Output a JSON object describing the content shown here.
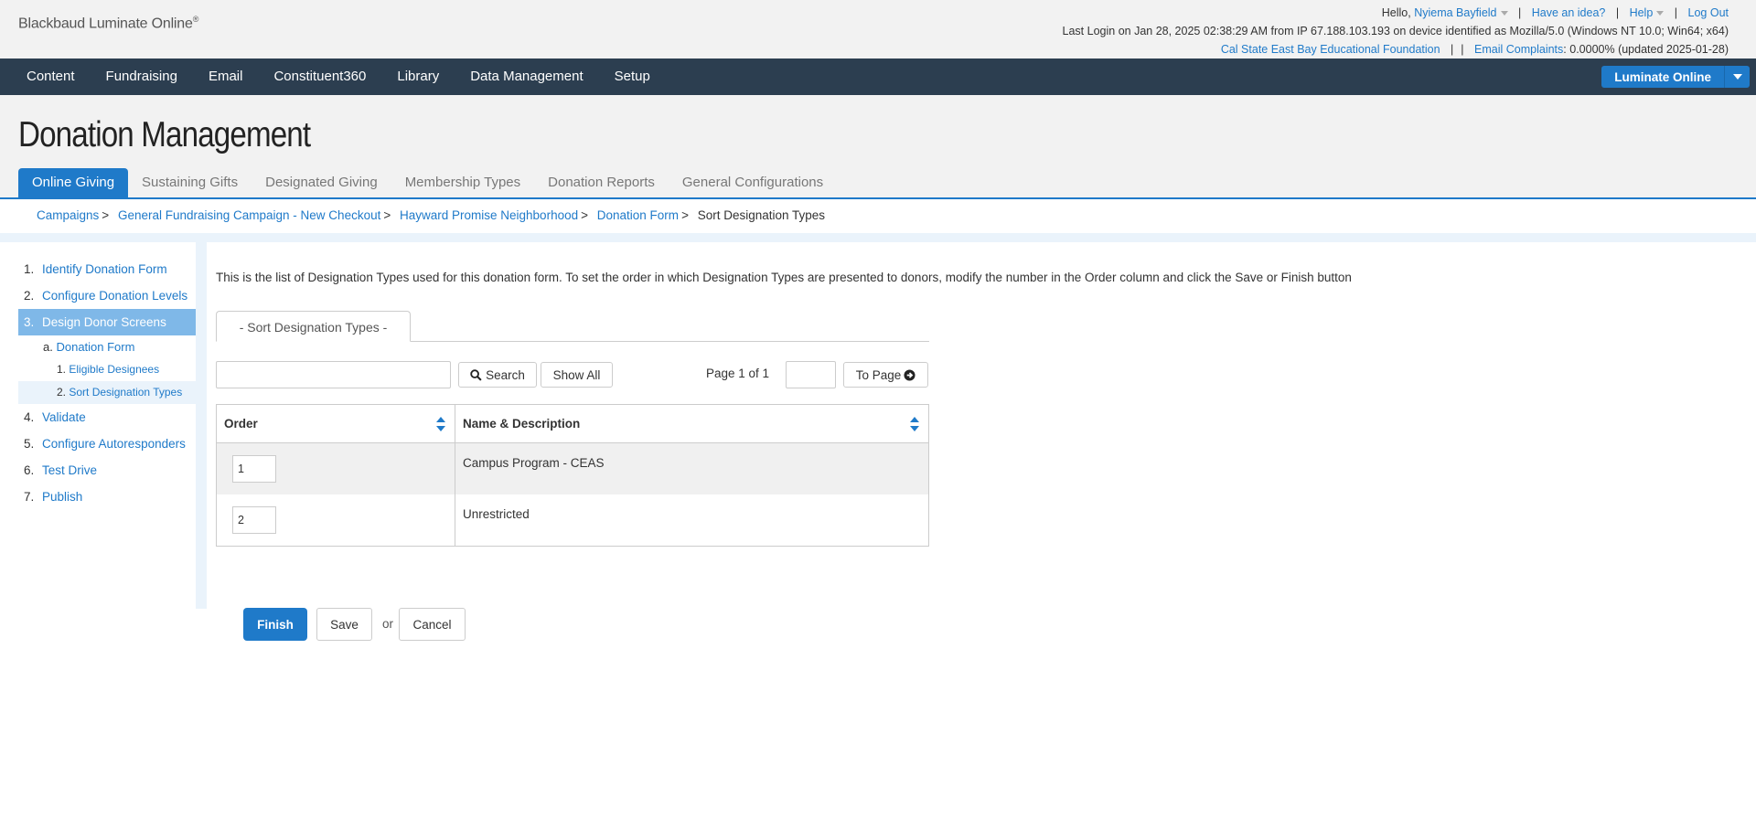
{
  "header": {
    "logo": "Blackbaud Luminate Online",
    "logo_mark": "®",
    "greeting": "Hello,",
    "user_name": "Nyiema Bayfield",
    "idea_link": "Have an idea?",
    "help_link": "Help",
    "logout_link": "Log Out",
    "last_login": "Last Login on Jan 28, 2025 02:38:29 AM from IP 67.188.103.193 on device identified as Mozilla/5.0 (Windows NT 10.0; Win64; x64)",
    "org_link": "Cal State East Bay Educational Foundation",
    "complaints_link": "Email Complaints",
    "complaints_value": ": 0.0000% (updated 2025-01-28)"
  },
  "nav": {
    "items": [
      "Content",
      "Fundraising",
      "Email",
      "Constituent360",
      "Library",
      "Data Management",
      "Setup"
    ],
    "product_button": "Luminate Online"
  },
  "page": {
    "title": "Donation Management",
    "tabs": [
      "Online Giving",
      "Sustaining Gifts",
      "Designated Giving",
      "Membership Types",
      "Donation Reports",
      "General Configurations"
    ]
  },
  "breadcrumb": {
    "items": [
      "Campaigns",
      "General Fundraising Campaign - New Checkout",
      "Hayward Promise Neighborhood",
      "Donation Form"
    ],
    "separator": ">",
    "current": "Sort Designation Types"
  },
  "sidebar": {
    "steps": [
      {
        "num": "1.",
        "label": "Identify Donation Form"
      },
      {
        "num": "2.",
        "label": "Configure Donation Levels"
      },
      {
        "num": "3.",
        "label": "Design Donor Screens"
      },
      {
        "num": "4.",
        "label": "Validate"
      },
      {
        "num": "5.",
        "label": "Configure Autoresponders"
      },
      {
        "num": "6.",
        "label": "Test Drive"
      },
      {
        "num": "7.",
        "label": "Publish"
      }
    ],
    "sub": {
      "num": "a.",
      "label": "Donation Form"
    },
    "subsub": [
      {
        "num": "1.",
        "label": "Eligible Designees"
      },
      {
        "num": "2.",
        "label": "Sort Designation Types"
      }
    ]
  },
  "main": {
    "intro": "This is the list of Designation Types used for this donation form. To set the order in which Designation Types are presented to donors, modify the number in the Order column and click the Save or Finish button",
    "section_tab": "- Sort Designation Types -",
    "search_button": "Search",
    "show_all_button": "Show All",
    "page_info": "Page 1 of 1",
    "to_page_button": "To Page",
    "columns": [
      "Order",
      "Name & Description"
    ],
    "rows": [
      {
        "order": "1",
        "name": "Campus Program - CEAS"
      },
      {
        "order": "2",
        "name": "Unrestricted"
      }
    ],
    "finish_button": "Finish",
    "save_button": "Save",
    "or_text": "or",
    "cancel_button": "Cancel"
  },
  "colors": {
    "accent": "#1f7ac9",
    "nav_bg": "#2c3e50",
    "sidebar_active": "#7fb8e8"
  }
}
